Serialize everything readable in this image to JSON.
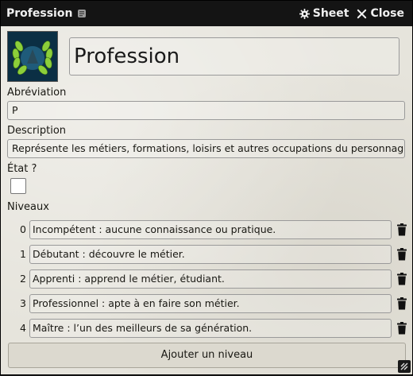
{
  "window": {
    "title": "Profession",
    "sheet_label": "Sheet",
    "close_label": "Close"
  },
  "item": {
    "name": "Profession"
  },
  "fields": {
    "abbreviation_label": "Abréviation",
    "abbreviation_value": "P",
    "description_label": "Description",
    "description_value": "Représente les métiers, formations, loisirs et autres occupations du personnage. En",
    "state_label": "État ?",
    "state_checked": false
  },
  "levels": {
    "label": "Niveaux",
    "rows": [
      {
        "index": "0",
        "text": "Incompétent : aucune connaissance ou pratique."
      },
      {
        "index": "1",
        "text": "Débutant : découvre le métier."
      },
      {
        "index": "2",
        "text": "Apprenti : apprend le métier, étudiant."
      },
      {
        "index": "3",
        "text": "Professionnel : apte à en faire son métier."
      },
      {
        "index": "4",
        "text": "Maître : l’un des meilleurs de sa génération."
      }
    ],
    "add_label": "Ajouter un niveau"
  },
  "icons": {
    "sheet": "gear-icon",
    "close": "close-icon",
    "delete": "trash-icon",
    "portrait": "laurel-wreath-icon",
    "resize": "resize-icon"
  }
}
